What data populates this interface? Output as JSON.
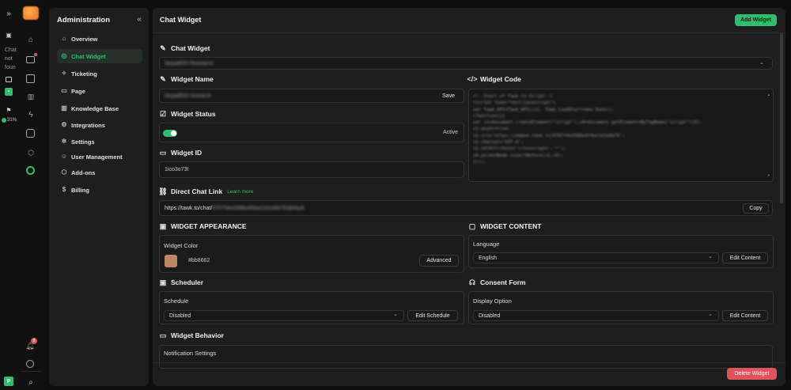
{
  "left_strip": {
    "chat_not_found": [
      "Chat",
      "not",
      "foun"
    ],
    "percent": "31%"
  },
  "rail": {
    "notification_count": "8"
  },
  "sidebar": {
    "title": "Administration",
    "items": [
      {
        "label": "Overview",
        "icon": "home-icon"
      },
      {
        "label": "Chat Widget",
        "icon": "chat-icon"
      },
      {
        "label": "Ticketing",
        "icon": "ticket-icon"
      },
      {
        "label": "Page",
        "icon": "page-icon"
      },
      {
        "label": "Knowledge Base",
        "icon": "book-icon"
      },
      {
        "label": "Integrations",
        "icon": "integrations-icon"
      },
      {
        "label": "Settings",
        "icon": "gear-icon"
      },
      {
        "label": "User Management",
        "icon": "users-icon"
      },
      {
        "label": "Add-ons",
        "icon": "addons-icon"
      },
      {
        "label": "Billing",
        "icon": "dollar-icon"
      }
    ]
  },
  "header": {
    "title": "Chat Widget",
    "add_widget": "Add Widget"
  },
  "chat_widget": {
    "heading": "Chat Widget",
    "selected": "Nepal833 Research"
  },
  "widget_name": {
    "heading": "Widget Name",
    "value": "Nepal833 research",
    "save": "Save"
  },
  "widget_status": {
    "heading": "Widget Status",
    "state": "Active"
  },
  "widget_id": {
    "heading": "Widget ID",
    "value": "1ico3o73t"
  },
  "widget_code": {
    "heading": "Widget Code",
    "lines": [
      "<!--Start of Tawk.to Script-->",
      "<script type=\"text/javascript\">",
      "var Tawk_API=Tawk_API||{}, Tawk_LoadStart=new Date();",
      "(function(){",
      "var s1=document.createElement(\"script\"),s0=document.getElementsByTagName(\"script\")[0];",
      "s1.async=true;",
      "s1.src='https://embed.tawk.to/6707f4e4388e4f4ee1d1e6b70';",
      "s1.charset='UTF-8';",
      "s1.setAttribute('crossorigin','*');",
      "s0.parentNode.insertBefore(s1,s0);",
      "})();"
    ]
  },
  "direct_link": {
    "heading": "Direct Chat Link",
    "learn_more": "Learn more",
    "url_prefix": "https://tawk.to/chat/",
    "url_rest": "6707f4e4388e4f4ee1d1e6b70/default",
    "copy": "Copy"
  },
  "appearance": {
    "heading": "WIDGET APPEARANCE",
    "color_label": "Widget Color",
    "color_value": "#bb8662",
    "color": "#bb8662",
    "advanced": "Advanced"
  },
  "content": {
    "heading": "WIDGET CONTENT",
    "language_label": "Language",
    "language_value": "English",
    "edit": "Edit Content"
  },
  "scheduler": {
    "heading": "Scheduler",
    "label": "Schedule",
    "value": "Disabled",
    "edit": "Edit Schedule"
  },
  "consent": {
    "heading": "Consent Form",
    "label": "Display Option",
    "value": "Disabled",
    "edit": "Edit Content"
  },
  "behavior": {
    "heading": "Widget Behavior",
    "label": "Notification Settings"
  },
  "footer": {
    "delete": "Delete Widget"
  },
  "colors": {
    "accent": "#2fbf6c",
    "danger": "#e0525c"
  }
}
